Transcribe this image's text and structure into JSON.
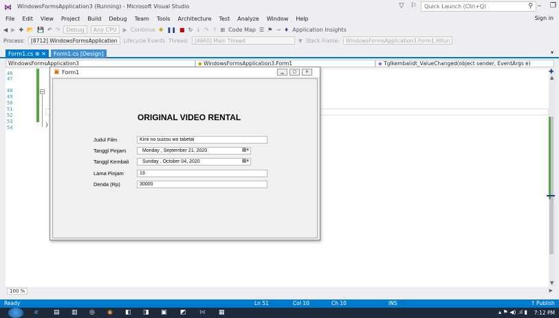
{
  "title_bar": {
    "window_title": "WindowsFormsApplication3 (Running) - Microsoft Visual Studio",
    "quick_launch_placeholder": "Quick Launch (Ctrl+Q)"
  },
  "menu": {
    "items": [
      "File",
      "Edit",
      "View",
      "Project",
      "Build",
      "Debug",
      "Team",
      "Tools",
      "Architecture",
      "Test",
      "Analyze",
      "Window",
      "Help"
    ],
    "sign_in": "Sign in"
  },
  "toolbar": {
    "config": "Debug",
    "platform": "Any CPU",
    "continue": "Continue",
    "code_map": "Code Map",
    "app_insights": "Application Insights"
  },
  "toolbar2": {
    "process_label": "Process:",
    "process_value": "[8712] WindowsFormsApplication",
    "lifecycle": "Lifecycle Events",
    "thread_label": "Thread:",
    "thread_value": "[4660] Main Thread",
    "stack_label": "Stack Frame:",
    "stack_value": "WindowsFormsApplication3.Form1.Hitun"
  },
  "tabs": {
    "active": "Form1.cs",
    "design": "Form1.cs [Design]"
  },
  "navbar": {
    "project": "WindowsFormsApplication3",
    "class": "WindowsFormsApplication3.Form1",
    "member": "Tglkembalidt_ValueChanged(object sender, EventArgs e)"
  },
  "editor": {
    "line_numbers": [
      "46",
      "47",
      "48",
      "49",
      "50",
      "51",
      "52",
      "53",
      "54"
    ],
    "close_brace": "}",
    "zoom": "100 %"
  },
  "form": {
    "title": "Form1",
    "heading": "ORIGINAL VIDEO RENTAL",
    "fields": {
      "judul_label": "Judul Film",
      "judul_value": "Kimi no suizou wo tabetai",
      "pinjam_label": "Tanggl Pinjam",
      "pinjam_value": "Monday   , September 21, 2020",
      "kembali_label": "Tanggl Kembali",
      "kembali_value": "Sunday   ,  October  04, 2020",
      "lama_label": "Lama Pinjam",
      "lama_value": "13",
      "denda_label": "Denda (Rp)",
      "denda_value": "30000"
    }
  },
  "status": {
    "ready": "Ready",
    "ln": "Ln 51",
    "col": "Col 10",
    "ch": "Ch 10",
    "ins": "INS",
    "publish": "Publish"
  },
  "taskbar": {
    "clock": "7:12 PM"
  },
  "colors": {
    "accent": "#007acc",
    "vs_purple": "#68217a",
    "change_green": "#57a64a"
  }
}
